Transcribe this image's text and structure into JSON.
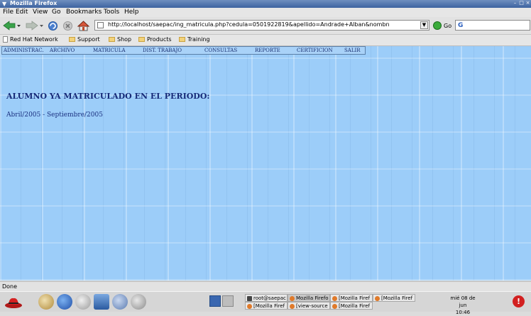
{
  "window": {
    "title": "Mozilla Firefox",
    "sysmenu_icon": "down-arrow-icon",
    "minimize_glyph": "–",
    "maximize_glyph": "□",
    "close_glyph": "×"
  },
  "menubar": {
    "items": [
      "File",
      "Edit",
      "View",
      "Go",
      "Bookmarks",
      "Tools",
      "Help"
    ]
  },
  "navbar": {
    "url": "http://localhost/saepac/ing_matricula.php?cedula=0501922819&apellido=Andrade+Alban&nombn",
    "go_label": "Go",
    "search_placeholder": "G"
  },
  "bookmarks": {
    "items": [
      "Red Hat Network",
      "Support",
      "Shop",
      "Products",
      "Training"
    ]
  },
  "site_menu": {
    "items": [
      "ADMINISTRAC.",
      "ARCHIVO",
      "MATRICULA",
      "DIST. TRABAJO",
      "CONSULTAS",
      "REPORTE",
      "CERTIFICION",
      "SALIR"
    ]
  },
  "main": {
    "heading": "ALUMNO YA MATRICULADO EN EL PERIODO:",
    "period": "Abril/2005 - Septiembre/2005"
  },
  "status": {
    "text": "Done"
  },
  "taskbar": {
    "tasks": [
      "root@saepac",
      "Mozilla Firefo",
      "[Mozilla Firef",
      "[Mozilla Firef",
      "[Mozilla Firef",
      "[view-source",
      "[Mozilla Firef"
    ],
    "clock_day": "mié 08 de jun",
    "clock_time": "10:46",
    "alert_glyph": "!"
  },
  "colors": {
    "content_bg": "#9ccdf9",
    "heading": "#162a78",
    "titlebar": "#3d63a0"
  }
}
